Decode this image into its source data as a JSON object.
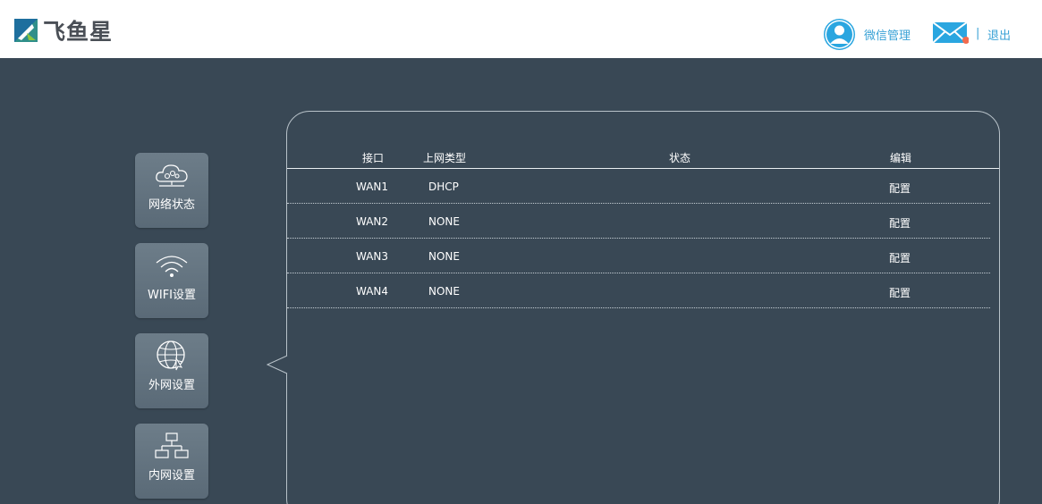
{
  "header": {
    "logo_text": "飞鱼星",
    "wechat_label": "微信管理",
    "separator": "|",
    "logout_label": "退出"
  },
  "nav": [
    {
      "label": "网络状态",
      "icon": "cloud-network-icon"
    },
    {
      "label": "WIFI设置",
      "icon": "wifi-icon"
    },
    {
      "label": "外网设置",
      "icon": "globe-icon"
    },
    {
      "label": "内网设置",
      "icon": "lan-topology-icon"
    }
  ],
  "table": {
    "headers": {
      "interface": "接口",
      "type": "上网类型",
      "status": "状态",
      "edit": "编辑"
    },
    "rows": [
      {
        "interface": "WAN1",
        "type": "DHCP",
        "status": "",
        "edit": "配置"
      },
      {
        "interface": "WAN2",
        "type": "NONE",
        "status": "",
        "edit": "配置"
      },
      {
        "interface": "WAN3",
        "type": "NONE",
        "status": "",
        "edit": "配置"
      },
      {
        "interface": "WAN4",
        "type": "NONE",
        "status": "",
        "edit": "配置"
      }
    ]
  },
  "colors": {
    "background": "#394855",
    "accent": "#3aa2d6",
    "notification_dot": "#f26b4e"
  }
}
